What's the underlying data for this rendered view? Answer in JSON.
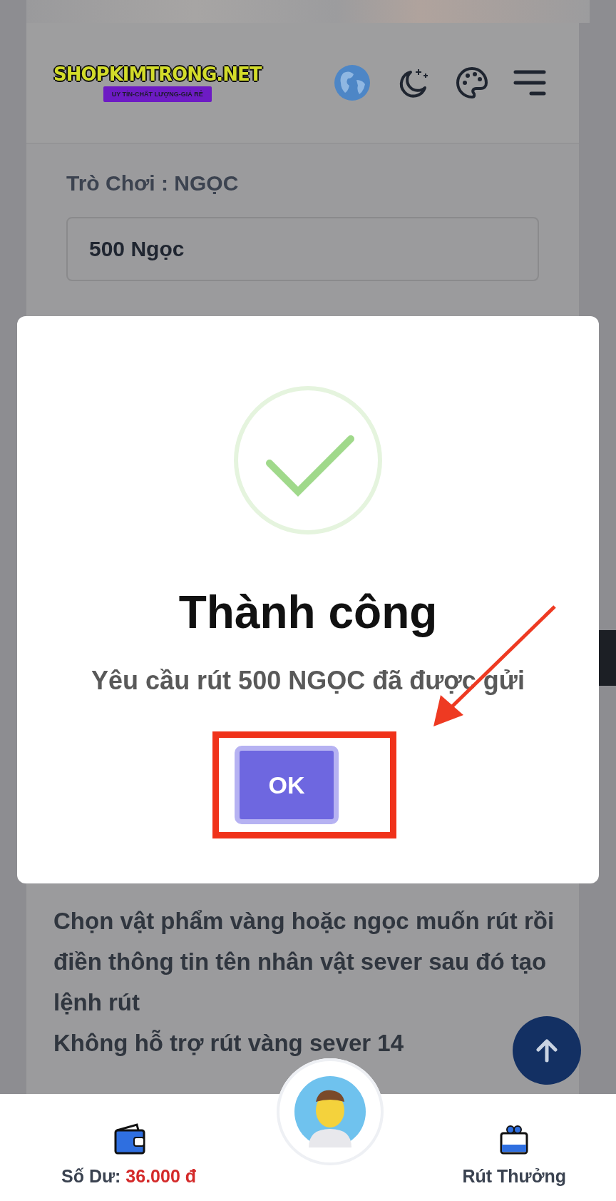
{
  "header": {
    "logo": "SHOPKIMTRONG.NET",
    "slogan": "UY TÍN-CHẤT LƯỢNG-GIÁ RẺ"
  },
  "form": {
    "label": "Trò Chơi : NGỌC",
    "value": "500 Ngọc"
  },
  "guide": {
    "lines": [
      "Chọn vật phẩm vàng hoặc ngọc muốn rút rồi điền thông tin tên nhân vật sever sau đó tạo lệnh rút",
      "Không hỗ trợ rút vàng sever 14"
    ]
  },
  "modal": {
    "title": "Thành công",
    "message": "Yêu cầu rút 500 NGỌC đã được gửi",
    "button": "OK"
  },
  "nav": {
    "balance_label": "Số Dư:",
    "balance": "36.000 đ",
    "withdraw": "Rút Thưởng"
  }
}
